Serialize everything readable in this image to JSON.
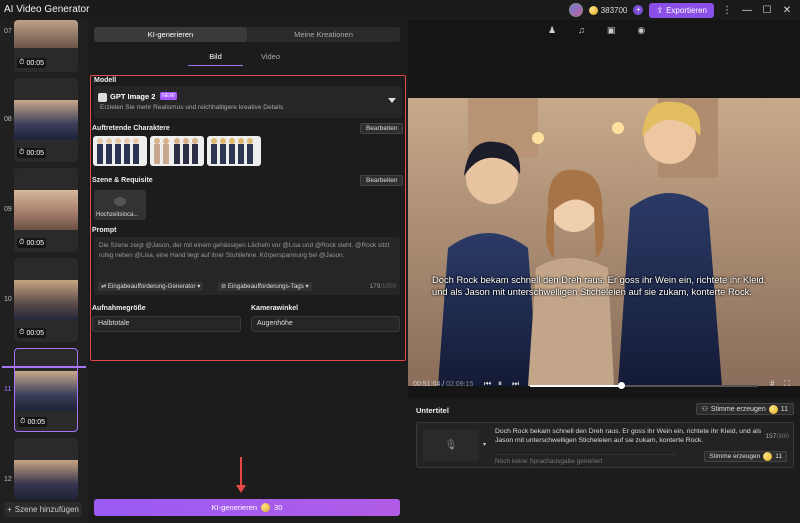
{
  "app": {
    "title": "AI Video Generator",
    "credits": "383700",
    "export_label": "Exportieren"
  },
  "scenes": [
    {
      "number": "07",
      "duration": "00:05"
    },
    {
      "number": "08",
      "duration": "00:05"
    },
    {
      "number": "09",
      "duration": "00:05"
    },
    {
      "number": "10",
      "duration": "00:05"
    },
    {
      "number": "11",
      "duration": "00:05"
    },
    {
      "number": "12",
      "duration": ""
    }
  ],
  "add_scene_label": "Szene hinzufügen",
  "panel": {
    "tabs": [
      "KI-generieren",
      "Meine Kreationen"
    ],
    "subtabs": [
      "Bild",
      "Video"
    ],
    "model_label": "Modell",
    "model_name": "GPT Image 2",
    "model_badge": "NEW",
    "model_desc": "Erzielen Sie mehr Realismus und reichhaltigere kreative Details",
    "characters_label": "Auftretende Charaktere",
    "edit_label": "Bearbeiten",
    "scene_label": "Szene & Requisite",
    "prop_name": "Hochzeitsloca...",
    "prompt_label": "Prompt",
    "prompt_text": "Die Szene zeigt @Jason, der mit einem gehässigen Lächeln vor @Lisa und @Rock steht. @Rock sitzt ruhig neben @Lisa, eine Hand liegt auf ihrer Stuhllehne. Körperspannung bei @Jason.",
    "chip_generator": "Eingabeaufforderung-Generator",
    "chip_tags": "Eingabeaufforderungs-Tags",
    "prompt_count": "179",
    "prompt_max": "/1000",
    "shot_size_label": "Aufnahmegröße",
    "shot_size_value": "Halbtotale",
    "camera_angle_label": "Kamerawinkel",
    "camera_angle_value": "Augenhöhe",
    "generate_label": "KI-generieren",
    "generate_cost": "30"
  },
  "preview": {
    "subtitle": "Doch Rock bekam schnell den Dreh raus. Er goss ihr Wein ein, richtete ihr Kleid, und als Jason mit unterschwelligen Sticheleien auf sie zukam, konterte Rock.",
    "time_current": "00:51:04",
    "time_total": "02:09:15",
    "progress": 0.4
  },
  "subtitles_panel": {
    "title": "Untertitel",
    "voice_btn": "Stimme erzeugen",
    "voice_cost": "11",
    "text": "Doch Rock bekam schnell den Dreh raus. Er goss ihr Wein ein, richtete ihr Kleid, und als Jason mit unterschwelligen Sticheleien auf sie zukam, konterte Rock.",
    "count": "157",
    "max": "/300",
    "status": "Noch keine Sprachausgabe generiert",
    "voice_btn2": "Stimme erzeugen",
    "voice_cost2": "11"
  }
}
